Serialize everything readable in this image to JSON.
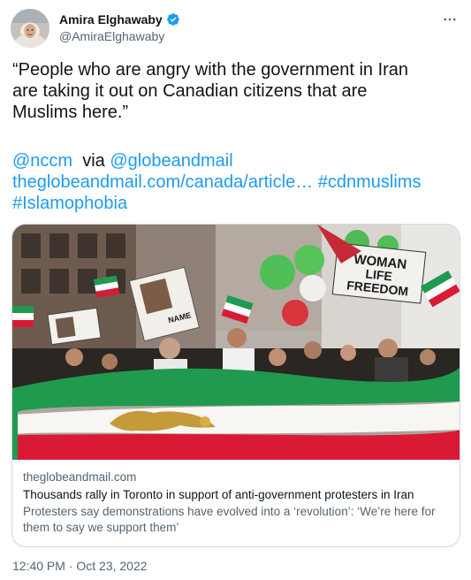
{
  "author": {
    "name": "Amira Elghawaby",
    "handle": "@AmiraElghawaby",
    "verified": true,
    "avatar_icon": "avatar-woman-hijab"
  },
  "tweet": {
    "quote_line1": "“People who are angry with the government in Iran",
    "quote_line2": "are taking it out on Canadian citizens that are",
    "quote_line3": "Muslims here.”",
    "mention_nccm": "@nccm",
    "via": "via",
    "mention_globe": "@globeandmail",
    "url": "theglobeandmail.com/canada/article…",
    "hashtag1": "#cdnmuslims",
    "hashtag2": "#Islamophobia"
  },
  "card": {
    "domain": "theglobeandmail.com",
    "headline": "Thousands rally in Toronto in support of anti-government protesters in Iran",
    "description": "Protesters say demonstrations have evolved into a ‘revolution’: ‘We’re here for them to say we support them’",
    "image_sign_text": "WOMAN LIFE FREEDOM",
    "image_sign2_text": "NAME"
  },
  "timestamp": "12:40 PM · Oct 23, 2022",
  "colors": {
    "link": "#1d9bf0",
    "verified": "#1d9bf0",
    "muted": "#536471",
    "border": "#cfd9de",
    "flag_green": "#1f9a4f",
    "flag_red": "#da1a35"
  },
  "icons": {
    "more": "more-horizontal-icon",
    "verified": "verified-badge-icon"
  }
}
